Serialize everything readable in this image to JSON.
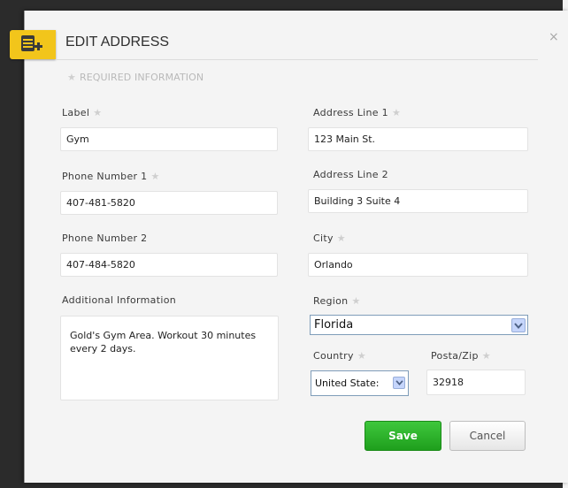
{
  "dialog": {
    "title": "EDIT ADDRESS",
    "close_glyph": "×",
    "required_note": "REQUIRED INFORMATION",
    "required_star": "★",
    "badge_icon": "address-book-add-icon",
    "colors": {
      "badge": "#f2c51b",
      "save": "#2db32b"
    }
  },
  "left": {
    "label": {
      "label": "Label",
      "value": "Gym",
      "required": true
    },
    "phone1": {
      "label": "Phone Number 1",
      "value": "407-481-5820",
      "required": true
    },
    "phone2": {
      "label": "Phone Number 2",
      "value": "407-484-5820",
      "required": false
    },
    "additional": {
      "label": "Additional Information",
      "value": "Gold's Gym Area. Workout 30 minutes every 2 days."
    }
  },
  "right": {
    "address1": {
      "label": "Address Line 1",
      "value": "123 Main St.",
      "required": true
    },
    "address2": {
      "label": "Address Line 2",
      "value": "Building 3 Suite 4",
      "required": false
    },
    "city": {
      "label": "City",
      "value": "Orlando",
      "required": true
    },
    "region": {
      "label": "Region",
      "value": "Florida",
      "required": true
    },
    "country": {
      "label": "Country",
      "value": "United State:",
      "required": true
    },
    "zip": {
      "label": "Posta/Zip",
      "value": "32918",
      "required": true
    }
  },
  "buttons": {
    "save": "Save",
    "cancel": "Cancel"
  }
}
